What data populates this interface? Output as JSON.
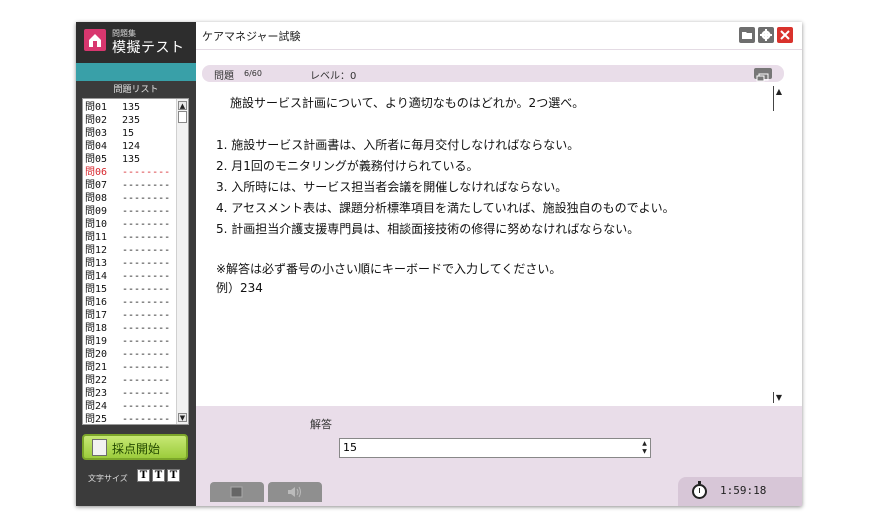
{
  "app": {
    "logo_small": "問題集",
    "logo_big": "模擬テスト",
    "window_title": "ケアマネジャー試験"
  },
  "sidebar": {
    "list_header": "問題リスト",
    "questions": [
      {
        "num": "問01",
        "answer": "135"
      },
      {
        "num": "問02",
        "answer": "235"
      },
      {
        "num": "問03",
        "answer": "15"
      },
      {
        "num": "問04",
        "answer": "124"
      },
      {
        "num": "問05",
        "answer": "135"
      },
      {
        "num": "問06",
        "answer": "--------",
        "current": true
      },
      {
        "num": "問07",
        "answer": "--------"
      },
      {
        "num": "問08",
        "answer": "--------"
      },
      {
        "num": "問09",
        "answer": "--------"
      },
      {
        "num": "問10",
        "answer": "--------"
      },
      {
        "num": "問11",
        "answer": "--------"
      },
      {
        "num": "問12",
        "answer": "--------"
      },
      {
        "num": "問13",
        "answer": "--------"
      },
      {
        "num": "問14",
        "answer": "--------"
      },
      {
        "num": "問15",
        "answer": "--------"
      },
      {
        "num": "問16",
        "answer": "--------"
      },
      {
        "num": "問17",
        "answer": "--------"
      },
      {
        "num": "問18",
        "answer": "--------"
      },
      {
        "num": "問19",
        "answer": "--------"
      },
      {
        "num": "問20",
        "answer": "--------"
      },
      {
        "num": "問21",
        "answer": "--------"
      },
      {
        "num": "問22",
        "answer": "--------"
      },
      {
        "num": "問23",
        "answer": "--------"
      },
      {
        "num": "問24",
        "answer": "--------"
      },
      {
        "num": "問25",
        "answer": "--------"
      }
    ],
    "grade_button": "採点開始",
    "font_size_label": "文字サイズ",
    "font_size_buttons": [
      "T",
      "T",
      "T"
    ]
  },
  "question": {
    "label": "問題",
    "count": "6/60",
    "level_label": "レベル：",
    "level_value": "0",
    "prompt": "施設サービス計画について、より適切なものはどれか。2つ選べ。",
    "options": [
      "1. 施設サービス計画書は、入所者に毎月交付しなければならない。",
      "2. 月1回のモニタリングが義務付けられている。",
      "3. 入所時には、サービス担当者会議を開催しなければならない。",
      "4. アセスメント表は、課題分析標準項目を満たしていれば、施設独自のものでよい。",
      "5. 計画担当介護支援専門員は、相談面接技術の修得に努めなければならない。"
    ],
    "note": "※解答は必ず番号の小さい順にキーボードで入力してください。",
    "example": "例）234"
  },
  "answer": {
    "label": "解答",
    "value": "15"
  },
  "timer": {
    "value": "1:59:18"
  },
  "colors": {
    "sidebar_bg": "#3b3b3b",
    "teal": "#39a0a8",
    "logo_pink": "#d8376f",
    "pane_lavender": "#e9dde9",
    "close_red": "#d9322c",
    "current_question": "#d6232a",
    "grade_button": "#9ccc3c"
  },
  "icons": {
    "logo": "home-icon",
    "folder": "folder-icon",
    "settings": "gear-icon",
    "close": "close-icon",
    "expand": "expand-icon",
    "timer": "stopwatch-icon",
    "image": "image-icon",
    "audio": "speaker-icon"
  }
}
